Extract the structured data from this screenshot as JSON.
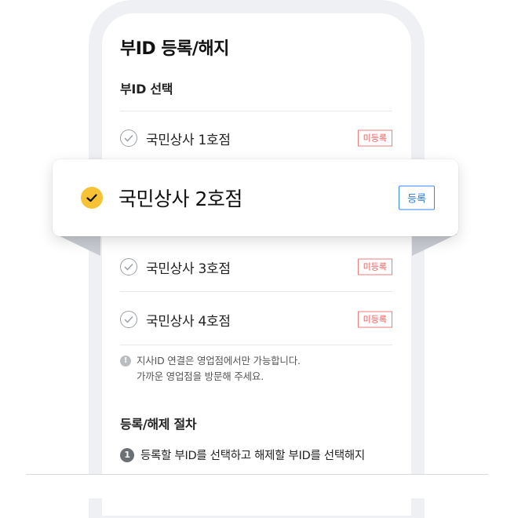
{
  "page": {
    "title": "부ID 등록/해지",
    "section_select": "부ID 선택",
    "section_procedure": "등록/해제 절차"
  },
  "stores": [
    {
      "name": "국민상사 1호점",
      "status": "미등록"
    },
    {
      "name": "국민상사 2호점",
      "status": "등록",
      "selected": true
    },
    {
      "name": "국민상사 3호점",
      "status": "미등록"
    },
    {
      "name": "국민상사 4호점",
      "status": "미등록"
    }
  ],
  "notice": {
    "line1": "지사ID 연결은 영업점에서만 가능합니다.",
    "line2": "가까운 영업점을 방문해 주세요.",
    "icon": "info-icon"
  },
  "steps": [
    {
      "num": "1",
      "text": "등록할 부ID를 선택하고 해제할 부ID를 선택해지"
    }
  ],
  "colors": {
    "accent_yellow": "#f7c236",
    "registered_blue": "#2f7be8",
    "unregistered_red": "#ef5a5a",
    "frame": "#eef0f3"
  }
}
